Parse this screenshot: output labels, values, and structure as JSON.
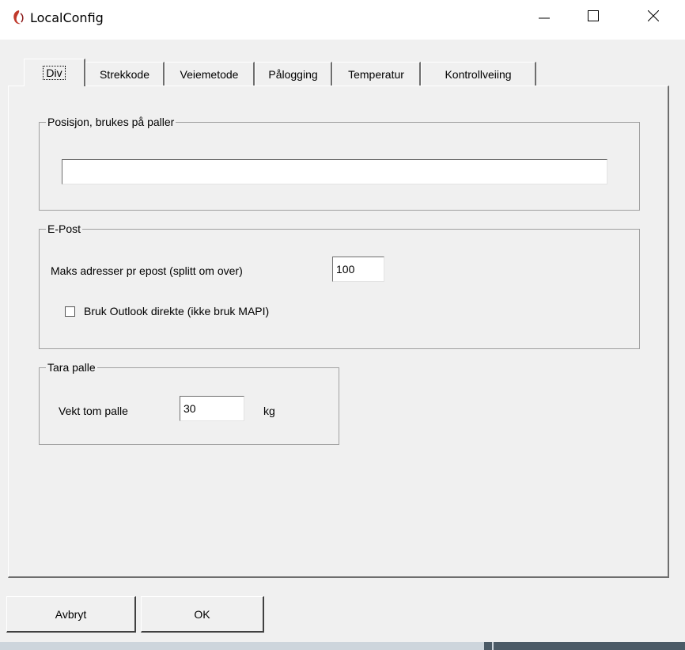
{
  "window": {
    "title": "LocalConfig"
  },
  "tabs": [
    {
      "label": "Div",
      "active": true
    },
    {
      "label": "Strekkode"
    },
    {
      "label": "Veiemetode"
    },
    {
      "label": "Pålogging"
    },
    {
      "label": "Temperatur"
    },
    {
      "label": "Kontrollveiing"
    }
  ],
  "posisjon": {
    "title": "Posisjon, brukes på paller",
    "value": ""
  },
  "epost": {
    "title": "E-Post",
    "max_label": "Maks adresser pr epost (splitt om over)",
    "max_value": "100",
    "outlook_label": "Bruk Outlook direkte (ikke bruk MAPI)",
    "outlook_checked": false
  },
  "tara": {
    "title": "Tara palle",
    "vekt_label": "Vekt tom palle",
    "vekt_value": "30",
    "unit": "kg"
  },
  "buttons": {
    "cancel": "Avbryt",
    "ok": "OK"
  }
}
